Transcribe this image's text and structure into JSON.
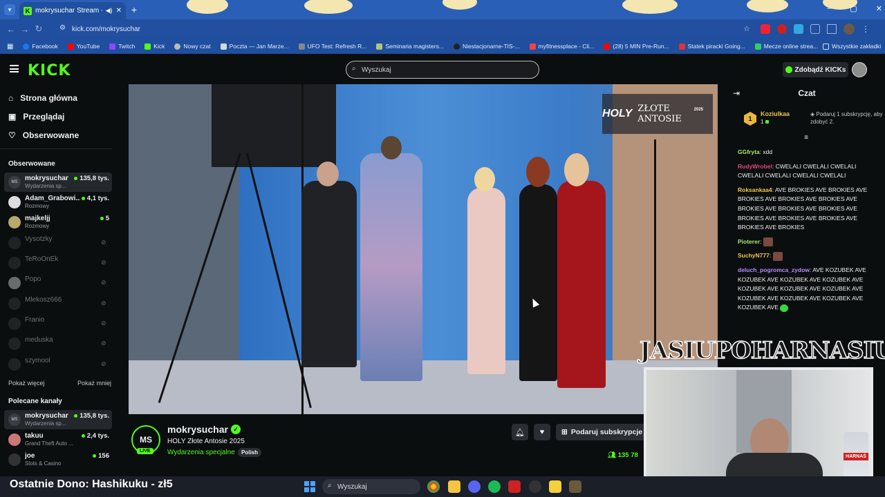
{
  "browser": {
    "tab_title": "mokrysuchar Stream - Wat",
    "url": "kick.com/mokrysuchar",
    "bookmarks": [
      "Facebook",
      "YouTube",
      "Twitch",
      "Kick",
      "Nowy czat",
      "Poczta — Jan Marze...",
      "UFO Test: Refresh R...",
      "Seminaria magisters...",
      "Niestacjonarne-TIS-...",
      "myfitnessplace - Cli...",
      "(28) 5 MIN Pre-Run...",
      "Statek piracki Going...",
      "Mecze online strea..."
    ],
    "all_bookmarks": "Wszystkie zakładki"
  },
  "header": {
    "logo": "KICK",
    "search_placeholder": "Wyszukaj",
    "kicks_button": "Zdobądź KICKs"
  },
  "sidebar": {
    "nav": [
      {
        "label": "Strona główna"
      },
      {
        "label": "Przeglądaj"
      },
      {
        "label": "Obserwowane"
      }
    ],
    "followed_header": "Obserwowane",
    "followed": [
      {
        "name": "mokrysuchar",
        "category": "Wydarzenia sp...",
        "viewers": "135,8 tys.",
        "avatar": "MS",
        "live": true
      },
      {
        "name": "Adam_Grabowi...",
        "category": "Rozmowy",
        "viewers": "4,1 tys.",
        "avatar": "",
        "live": true
      },
      {
        "name": "majkeljj",
        "category": "Rozmowy",
        "viewers": "5",
        "avatar": "",
        "live": true
      },
      {
        "name": "Vysotzky",
        "live": false
      },
      {
        "name": "TeRoOnEk",
        "live": false
      },
      {
        "name": "Popo",
        "live": false
      },
      {
        "name": "Mlekosz666",
        "live": false
      },
      {
        "name": "Franio",
        "live": false
      },
      {
        "name": "meduska",
        "live": false
      },
      {
        "name": "szymool",
        "live": false
      }
    ],
    "show_more": "Pokaż więcej",
    "show_less": "Pokaż mniej",
    "recommended_header": "Polecane kanały",
    "recommended": [
      {
        "name": "mokrysuchar",
        "category": "Wydarzenia sp...",
        "viewers": "135,8 tys.",
        "avatar": "MS"
      },
      {
        "name": "takuu",
        "category": "Grand Theft Auto ...",
        "viewers": "2,4 tys.",
        "avatar": ""
      },
      {
        "name": "joe",
        "category": "Slots & Casino",
        "viewers": "156",
        "avatar": ""
      }
    ]
  },
  "video": {
    "overlay_logo": "HOLY",
    "overlay_event": "ZŁOTE ANTOSIE",
    "overlay_year": "2025"
  },
  "stream": {
    "avatar": "MS",
    "live_badge": "LIVE",
    "streamer": "mokrysuchar",
    "title": "HOLY Złote Antosie 2025",
    "category": "Wydarzenia specjalne",
    "language": "Polish",
    "subscribe_button": "Podaruj subskrypcje",
    "viewers": "135 78"
  },
  "chat": {
    "title": "Czat",
    "pinned": {
      "rank": "1",
      "user": "Koziulkaa",
      "count": "1",
      "text": "Podaruj 1 subskrypcję, aby zdobyć 2."
    },
    "messages": [
      {
        "user": "GGfryta",
        "color": "#a8e86a",
        "text": "xdd"
      },
      {
        "user": "RudyWrobel",
        "color": "#e0457b",
        "text": "CWELALI CWELALI CWELALI CWELALI CWELALI CWELALI CWELALI"
      },
      {
        "user": "Roksankaa4",
        "color": "#f2c94c",
        "text": "AVE BROKIES AVE BROKIES AVE BROKIES AVE BROKIES AVE BROKIES AVE BROKIES AVE BROKIES AVE BROKIES AVE BROKIES AVE BROKIES AVE BROKIES AVE BROKIES AVE BROKIES"
      },
      {
        "user": "Pioterer",
        "color": "#a8e86a",
        "text": ""
      },
      {
        "user": "SuchyN777",
        "color": "#f2c94c",
        "text": ""
      },
      {
        "user": "deluch_pogromca_zydow",
        "color": "#b48cff",
        "text": "AVE KOZUBEK AVE KOZUBEK AVE KOZUBEK AVE KOZUBEK AVE KOZUBEK AVE KOZUBEK AVE KOZUBEK AVE KOZUBEK AVE KOZUBEK AVE KOZUBEK AVE KOZUBEK AVE"
      }
    ]
  },
  "webcam": {
    "title": "JASIUPOHARNASIU",
    "can_label": "HARNAŚ"
  },
  "taskbar": {
    "donation": "Ostatnie Dono: Hashikuku - zł5",
    "search": "Wyszukaj"
  }
}
